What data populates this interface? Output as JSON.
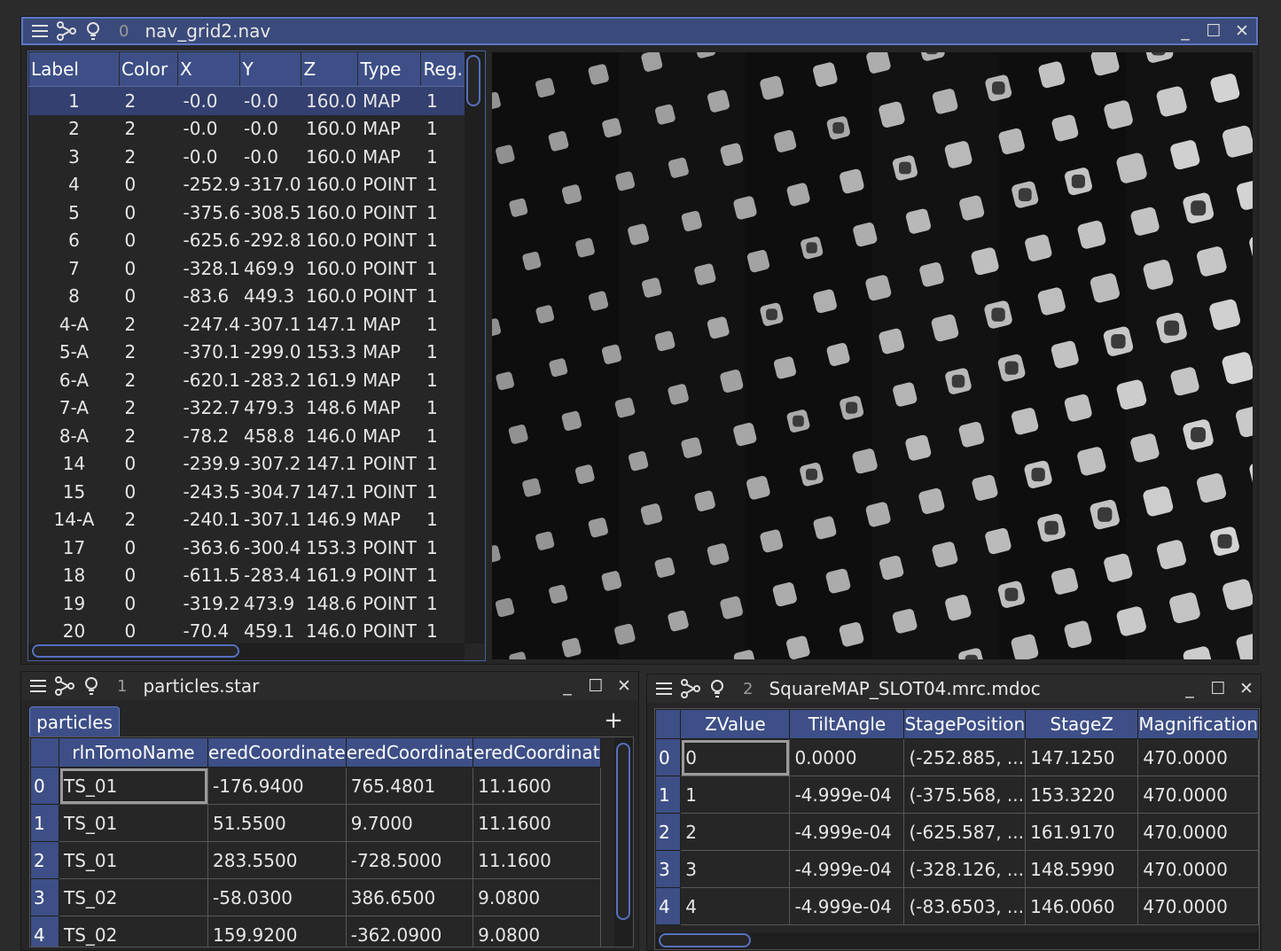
{
  "nav_window": {
    "number": "0",
    "title": "nav_grid2.nav",
    "columns": [
      "Label",
      "Color",
      "X",
      "Y",
      "Z",
      "Type",
      "Reg."
    ],
    "rows": [
      [
        "1",
        "2",
        "-0.0",
        "-0.0",
        "160.0",
        "MAP",
        "1"
      ],
      [
        "2",
        "2",
        "-0.0",
        "-0.0",
        "160.0",
        "MAP",
        "1"
      ],
      [
        "3",
        "2",
        "-0.0",
        "-0.0",
        "160.0",
        "MAP",
        "1"
      ],
      [
        "4",
        "0",
        "-252.9",
        "-317.0",
        "160.0",
        "POINT",
        "1"
      ],
      [
        "5",
        "0",
        "-375.6",
        "-308.5",
        "160.0",
        "POINT",
        "1"
      ],
      [
        "6",
        "0",
        "-625.6",
        "-292.8",
        "160.0",
        "POINT",
        "1"
      ],
      [
        "7",
        "0",
        "-328.1",
        "469.9",
        "160.0",
        "POINT",
        "1"
      ],
      [
        "8",
        "0",
        "-83.6",
        "449.3",
        "160.0",
        "POINT",
        "1"
      ],
      [
        "4-A",
        "2",
        "-247.4",
        "-307.1",
        "147.1",
        "MAP",
        "1"
      ],
      [
        "5-A",
        "2",
        "-370.1",
        "-299.0",
        "153.3",
        "MAP",
        "1"
      ],
      [
        "6-A",
        "2",
        "-620.1",
        "-283.2",
        "161.9",
        "MAP",
        "1"
      ],
      [
        "7-A",
        "2",
        "-322.7",
        "479.3",
        "148.6",
        "MAP",
        "1"
      ],
      [
        "8-A",
        "2",
        "-78.2",
        "458.8",
        "146.0",
        "MAP",
        "1"
      ],
      [
        "14",
        "0",
        "-239.9",
        "-307.2",
        "147.1",
        "POINT",
        "1"
      ],
      [
        "15",
        "0",
        "-243.5",
        "-304.7",
        "147.1",
        "POINT",
        "1"
      ],
      [
        "14-A",
        "2",
        "-240.1",
        "-307.1",
        "146.9",
        "MAP",
        "1"
      ],
      [
        "17",
        "0",
        "-363.6",
        "-300.4",
        "153.3",
        "POINT",
        "1"
      ],
      [
        "18",
        "0",
        "-611.5",
        "-283.4",
        "161.9",
        "POINT",
        "1"
      ],
      [
        "19",
        "0",
        "-319.2",
        "473.9",
        "148.6",
        "POINT",
        "1"
      ],
      [
        "20",
        "0",
        "-70.4",
        "459.1",
        "146.0",
        "POINT",
        "1"
      ]
    ]
  },
  "particles_window": {
    "number": "1",
    "title": "particles.star",
    "tab_label": "particles",
    "add_label": "+",
    "columns": [
      "rlnTomoName",
      "eredCoordinate",
      "eredCoordinat",
      "eredCoordinat"
    ],
    "rows": [
      [
        "0",
        "TS_01",
        "-176.9400",
        "765.4801",
        "11.1600"
      ],
      [
        "1",
        "TS_01",
        "51.5500",
        "9.7000",
        "11.1600"
      ],
      [
        "2",
        "TS_01",
        "283.5500",
        "-728.5000",
        "11.1600"
      ],
      [
        "3",
        "TS_02",
        "-58.0300",
        "386.6500",
        "9.0800"
      ],
      [
        "4",
        "TS_02",
        "159.9200",
        "-362.0900",
        "9.0800"
      ]
    ]
  },
  "mdoc_window": {
    "number": "2",
    "title": "SquareMAP_SLOT04.mrc.mdoc",
    "columns": [
      "ZValue",
      "TiltAngle",
      "StagePosition",
      "StageZ",
      "Magnification"
    ],
    "rows": [
      [
        "0",
        "0",
        "0.0000",
        "(-252.885, ...",
        "147.1250",
        "470.0000"
      ],
      [
        "1",
        "1",
        "-4.999e-04",
        "(-375.568, ...",
        "153.3220",
        "470.0000"
      ],
      [
        "2",
        "2",
        "-4.999e-04",
        "(-625.587, ...",
        "161.9170",
        "470.0000"
      ],
      [
        "3",
        "3",
        "-4.999e-04",
        "(-328.126, ...",
        "148.5990",
        "470.0000"
      ],
      [
        "4",
        "4",
        "-4.999e-04",
        "(-83.6503, ...",
        "146.0060",
        "470.0000"
      ]
    ]
  },
  "window_buttons": {
    "minimize": "_",
    "maximize": "☐",
    "close": "✕"
  },
  "icons": [
    "menu-icon",
    "branch-icon",
    "lightbulb-icon"
  ],
  "colors": {
    "accent": "#3d4f86",
    "accent_border": "#5d77c4",
    "selection": "#334070"
  }
}
